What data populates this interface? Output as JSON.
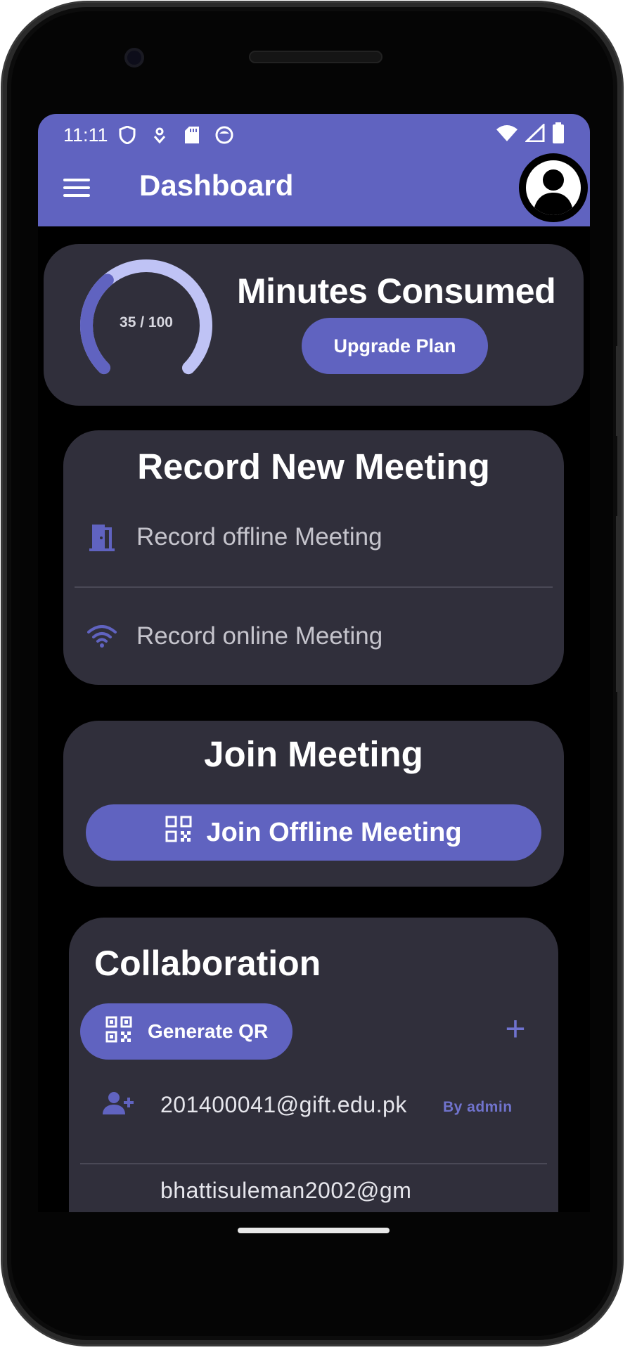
{
  "status_bar": {
    "time": "11:11",
    "left_icons": [
      "shield-icon",
      "usb-debug-icon",
      "sd-card-icon",
      "app-notification-icon"
    ],
    "right_icons": [
      "wifi-icon",
      "cell-signal-icon",
      "battery-icon"
    ]
  },
  "app_bar": {
    "title": "Dashboard",
    "accent_color": "#6063c0"
  },
  "minutes_card": {
    "gauge_label": "35 / 100",
    "consumed": 35,
    "total": 100,
    "title": "Minutes Consumed",
    "upgrade_label": "Upgrade Plan"
  },
  "record_card": {
    "title": "Record New Meeting",
    "items": [
      {
        "icon": "door-icon",
        "label": "Record offline Meeting"
      },
      {
        "icon": "wifi-icon",
        "label": "Record online Meeting"
      }
    ]
  },
  "join_card": {
    "title": "Join Meeting",
    "button_label": "Join Offline Meeting"
  },
  "collab_card": {
    "title": "Collaboration",
    "generate_qr_label": "Generate QR",
    "add_symbol": "+",
    "members": [
      {
        "email": "201400041@gift.edu.pk",
        "by": "By admin"
      },
      {
        "email": "bhattisuleman2002@gm",
        "by": ""
      }
    ]
  }
}
